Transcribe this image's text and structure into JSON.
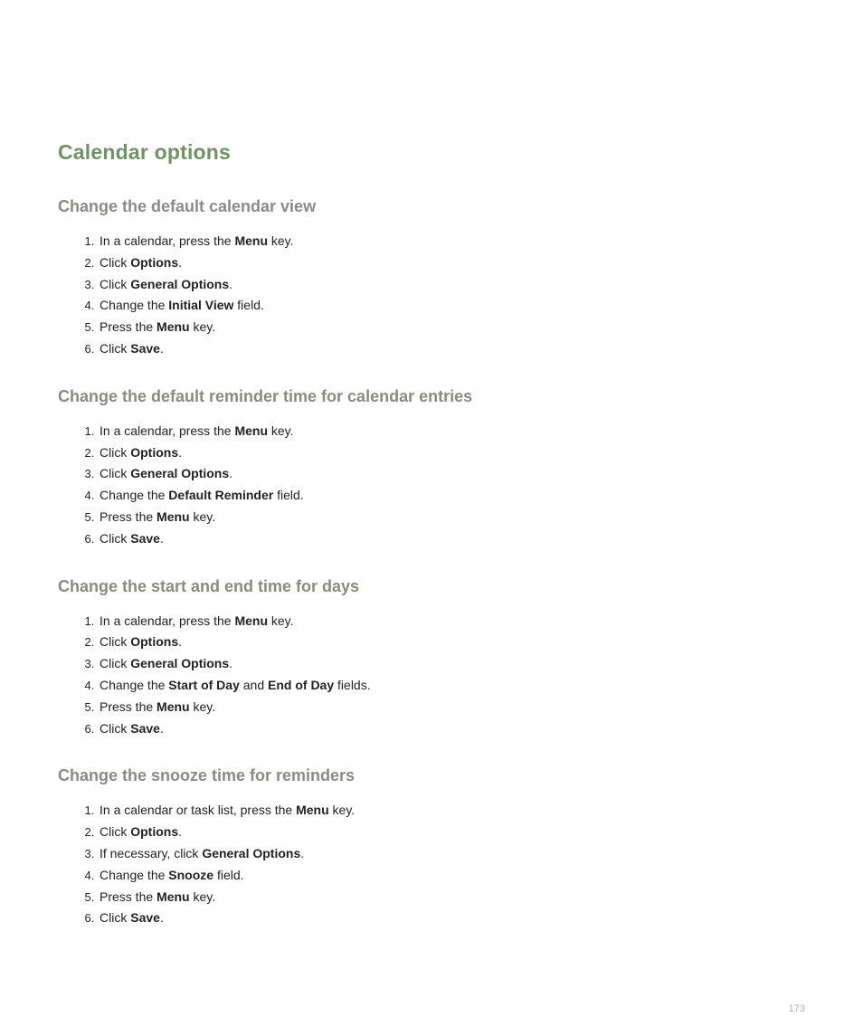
{
  "title": "Calendar options",
  "page_number": "173",
  "sections": [
    {
      "heading": "Change the default calendar view",
      "steps": [
        [
          {
            "t": "In a calendar, press the ",
            "b": false
          },
          {
            "t": "Menu",
            "b": true
          },
          {
            "t": " key.",
            "b": false
          }
        ],
        [
          {
            "t": "Click ",
            "b": false
          },
          {
            "t": "Options",
            "b": true
          },
          {
            "t": ".",
            "b": false
          }
        ],
        [
          {
            "t": "Click ",
            "b": false
          },
          {
            "t": "General Options",
            "b": true
          },
          {
            "t": ".",
            "b": false
          }
        ],
        [
          {
            "t": "Change the ",
            "b": false
          },
          {
            "t": "Initial View",
            "b": true
          },
          {
            "t": " field.",
            "b": false
          }
        ],
        [
          {
            "t": "Press the ",
            "b": false
          },
          {
            "t": "Menu",
            "b": true
          },
          {
            "t": " key.",
            "b": false
          }
        ],
        [
          {
            "t": "Click ",
            "b": false
          },
          {
            "t": "Save",
            "b": true
          },
          {
            "t": ".",
            "b": false
          }
        ]
      ]
    },
    {
      "heading": "Change the default reminder time for calendar entries",
      "steps": [
        [
          {
            "t": "In a calendar, press the ",
            "b": false
          },
          {
            "t": "Menu",
            "b": true
          },
          {
            "t": " key.",
            "b": false
          }
        ],
        [
          {
            "t": "Click ",
            "b": false
          },
          {
            "t": "Options",
            "b": true
          },
          {
            "t": ".",
            "b": false
          }
        ],
        [
          {
            "t": "Click ",
            "b": false
          },
          {
            "t": "General Options",
            "b": true
          },
          {
            "t": ".",
            "b": false
          }
        ],
        [
          {
            "t": "Change the ",
            "b": false
          },
          {
            "t": "Default Reminder",
            "b": true
          },
          {
            "t": " field.",
            "b": false
          }
        ],
        [
          {
            "t": "Press the ",
            "b": false
          },
          {
            "t": "Menu",
            "b": true
          },
          {
            "t": " key.",
            "b": false
          }
        ],
        [
          {
            "t": "Click ",
            "b": false
          },
          {
            "t": "Save",
            "b": true
          },
          {
            "t": ".",
            "b": false
          }
        ]
      ]
    },
    {
      "heading": "Change the start and end time for days",
      "steps": [
        [
          {
            "t": "In a calendar, press the ",
            "b": false
          },
          {
            "t": "Menu",
            "b": true
          },
          {
            "t": " key.",
            "b": false
          }
        ],
        [
          {
            "t": "Click ",
            "b": false
          },
          {
            "t": "Options",
            "b": true
          },
          {
            "t": ".",
            "b": false
          }
        ],
        [
          {
            "t": "Click ",
            "b": false
          },
          {
            "t": "General Options",
            "b": true
          },
          {
            "t": ".",
            "b": false
          }
        ],
        [
          {
            "t": "Change the ",
            "b": false
          },
          {
            "t": "Start of Day",
            "b": true
          },
          {
            "t": " and ",
            "b": false
          },
          {
            "t": "End of Day",
            "b": true
          },
          {
            "t": " fields.",
            "b": false
          }
        ],
        [
          {
            "t": "Press the ",
            "b": false
          },
          {
            "t": "Menu",
            "b": true
          },
          {
            "t": " key.",
            "b": false
          }
        ],
        [
          {
            "t": "Click ",
            "b": false
          },
          {
            "t": "Save",
            "b": true
          },
          {
            "t": ".",
            "b": false
          }
        ]
      ]
    },
    {
      "heading": "Change the snooze time for reminders",
      "steps": [
        [
          {
            "t": "In a calendar or task list, press the ",
            "b": false
          },
          {
            "t": "Menu",
            "b": true
          },
          {
            "t": " key.",
            "b": false
          }
        ],
        [
          {
            "t": "Click ",
            "b": false
          },
          {
            "t": "Options",
            "b": true
          },
          {
            "t": ".",
            "b": false
          }
        ],
        [
          {
            "t": "If necessary, click ",
            "b": false
          },
          {
            "t": "General Options",
            "b": true
          },
          {
            "t": ".",
            "b": false
          }
        ],
        [
          {
            "t": "Change the ",
            "b": false
          },
          {
            "t": "Snooze",
            "b": true
          },
          {
            "t": " field.",
            "b": false
          }
        ],
        [
          {
            "t": "Press the ",
            "b": false
          },
          {
            "t": "Menu",
            "b": true
          },
          {
            "t": " key.",
            "b": false
          }
        ],
        [
          {
            "t": "Click ",
            "b": false
          },
          {
            "t": "Save",
            "b": true
          },
          {
            "t": ".",
            "b": false
          }
        ]
      ]
    }
  ]
}
